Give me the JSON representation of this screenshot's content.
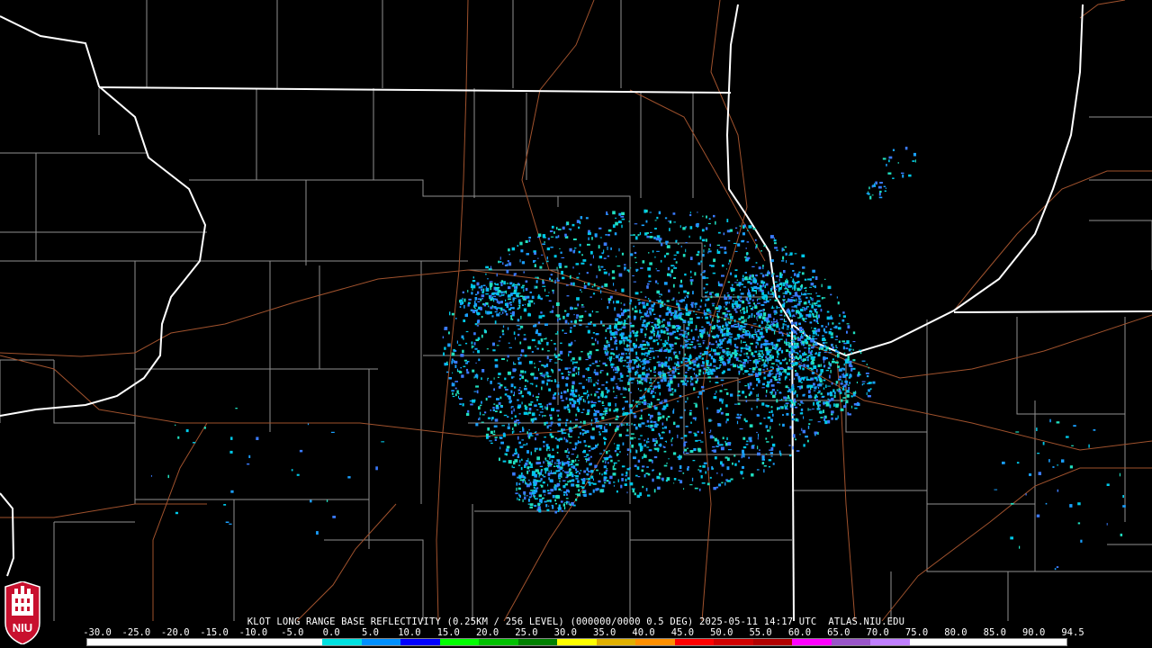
{
  "product": {
    "caption": "KLOT LONG RANGE BASE REFLECTIVITY (0.25KM / 256 LEVEL) (000000/0000 0.5 DEG) 2025-05-11 14:17 UTC  ATLAS.NIU.EDU"
  },
  "legend": {
    "labels": [
      "-30.0",
      "-25.0",
      "-20.0",
      "-15.0",
      "-10.0",
      "-5.0",
      "0.0",
      "5.0",
      "10.0",
      "15.0",
      "20.0",
      "25.0",
      "30.0",
      "35.0",
      "40.0",
      "45.0",
      "50.0",
      "55.0",
      "60.0",
      "65.0",
      "70.0",
      "75.0",
      "80.0",
      "85.0",
      "90.0",
      "94.5"
    ],
    "colors": [
      "#ffffff",
      "#ffffff",
      "#ffffff",
      "#ffffff",
      "#ffffff",
      "#ffffff",
      "#00e0e0",
      "#0090ff",
      "#0000ff",
      "#00ff00",
      "#00c000",
      "#008000",
      "#ffff00",
      "#e0b000",
      "#ff9000",
      "#ff0000",
      "#d00000",
      "#b00000",
      "#ff00ff",
      "#9955c9",
      "#c080ff",
      "#ffffff",
      "#ffffff",
      "#ffffff",
      "#ffffff"
    ]
  },
  "logo": {
    "text": "NIU",
    "color": "#c8102e"
  },
  "map": {
    "background": "#000000",
    "state_border_color": "#ffffff",
    "county_color": "#909090",
    "road_color": "#a0522d",
    "echo_colors": [
      "#00c8e8",
      "#1aa0ff",
      "#3b7bff",
      "#20e0c0"
    ]
  }
}
